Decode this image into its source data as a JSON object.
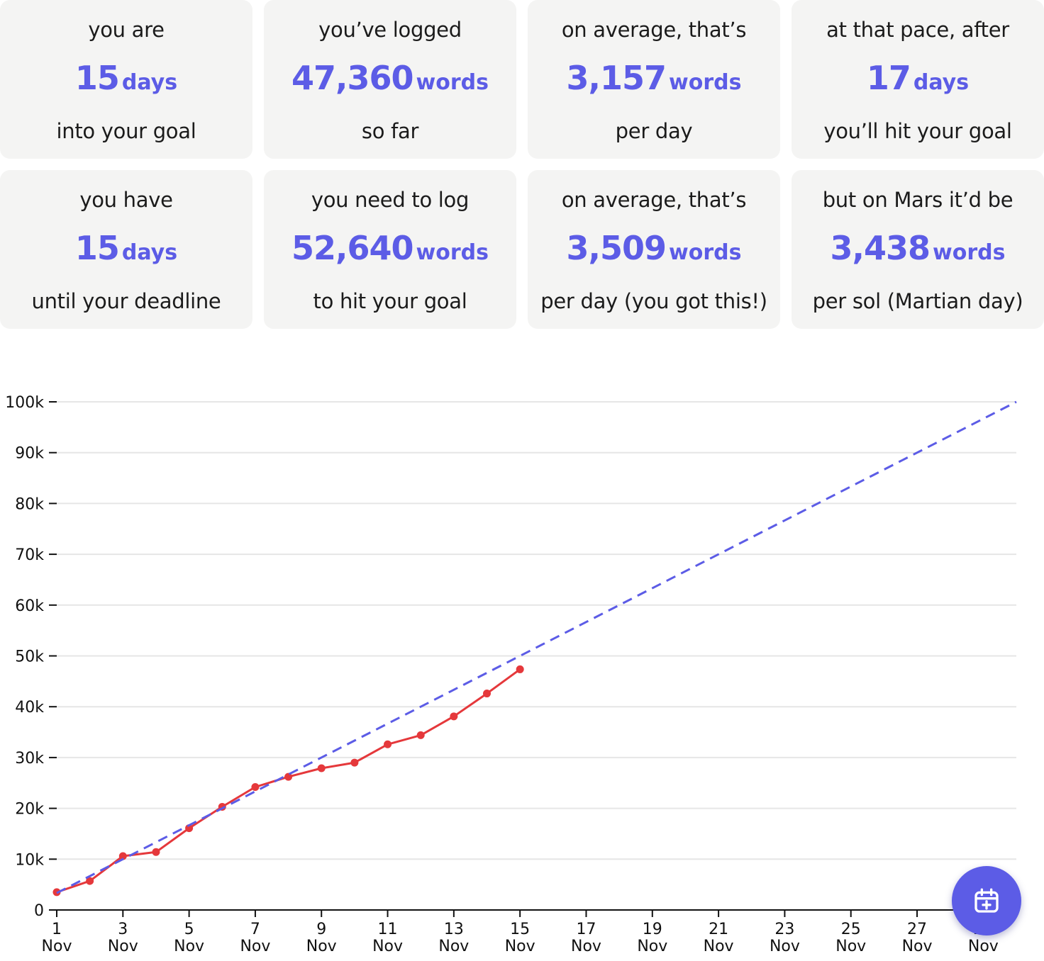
{
  "stats": [
    {
      "top": "you are",
      "number": "15",
      "unit": "days",
      "bottom": "into your goal"
    },
    {
      "top": "you’ve logged",
      "number": "47,360",
      "unit": "words",
      "bottom": "so far"
    },
    {
      "top": "on average, that’s",
      "number": "3,157",
      "unit": "words",
      "bottom": "per day"
    },
    {
      "top": "at that pace, after",
      "number": "17",
      "unit": "days",
      "bottom": "you’ll hit your goal"
    },
    {
      "top": "you have",
      "number": "15",
      "unit": "days",
      "bottom": "until your deadline"
    },
    {
      "top": "you need to log",
      "number": "52,640",
      "unit": "words",
      "bottom": "to hit your goal"
    },
    {
      "top": "on average, that’s",
      "number": "3,509",
      "unit": "words",
      "bottom": "per day (you got this!)"
    },
    {
      "top": "but on Mars it’d be",
      "number": "3,438",
      "unit": "words",
      "bottom": "per sol (Martian day)"
    }
  ],
  "fab": {
    "icon": "calendar-plus-icon"
  },
  "colors": {
    "accent": "#5c5ce6",
    "actual_line": "#e5383b",
    "card_bg": "#f4f4f3",
    "grid": "#e6e6e6"
  },
  "chart_data": {
    "type": "line",
    "title": "",
    "xlabel": "",
    "ylabel": "",
    "x_days": [
      1,
      30
    ],
    "x_ticks": [
      {
        "day": "1",
        "month": "Nov"
      },
      {
        "day": "3",
        "month": "Nov"
      },
      {
        "day": "5",
        "month": "Nov"
      },
      {
        "day": "7",
        "month": "Nov"
      },
      {
        "day": "9",
        "month": "Nov"
      },
      {
        "day": "11",
        "month": "Nov"
      },
      {
        "day": "13",
        "month": "Nov"
      },
      {
        "day": "15",
        "month": "Nov"
      },
      {
        "day": "17",
        "month": "Nov"
      },
      {
        "day": "19",
        "month": "Nov"
      },
      {
        "day": "21",
        "month": "Nov"
      },
      {
        "day": "23",
        "month": "Nov"
      },
      {
        "day": "25",
        "month": "Nov"
      },
      {
        "day": "27",
        "month": "Nov"
      },
      {
        "day": "29",
        "month": "Nov"
      }
    ],
    "y_ticks": [
      "0",
      "10k",
      "20k",
      "30k",
      "40k",
      "50k",
      "60k",
      "70k",
      "80k",
      "90k",
      "100k"
    ],
    "ylim": [
      0,
      100000
    ],
    "grid": true,
    "series": [
      {
        "style": "solid-with-markers",
        "color": "#e5383b",
        "x": [
          1,
          2,
          3,
          4,
          5,
          6,
          7,
          8,
          9,
          10,
          11,
          12,
          13,
          14,
          15
        ],
        "values": [
          3500,
          5700,
          10600,
          11400,
          16100,
          20300,
          24200,
          26200,
          27900,
          29000,
          32600,
          34400,
          38100,
          42600,
          47360
        ]
      },
      {
        "style": "dashed",
        "color": "#5c5ce6",
        "x": [
          1,
          30
        ],
        "values": [
          3333,
          100000
        ]
      }
    ]
  }
}
